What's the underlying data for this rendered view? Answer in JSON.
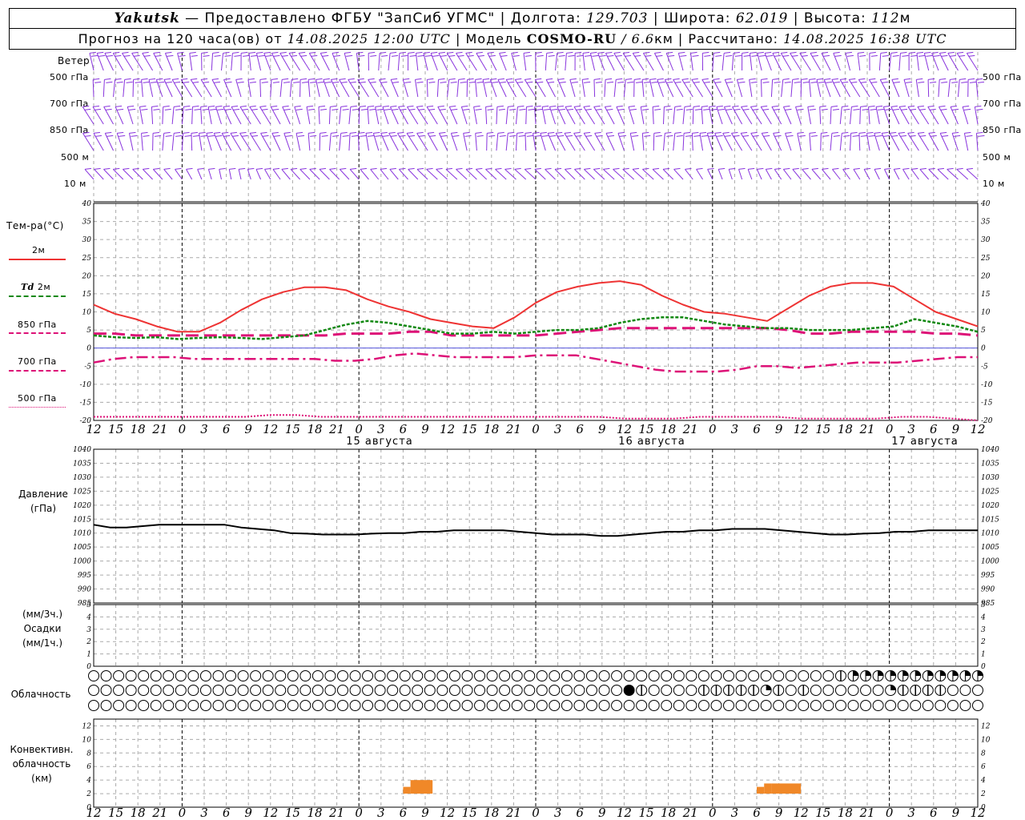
{
  "header": {
    "station": "Yakutsk",
    "provider": " — Предоставлено ФГБУ \"ЗапСиб УГМС\" | Долгота: ",
    "lon": "129.703",
    "lat_label": " | Широта: ",
    "lat": "62.019",
    "alt_label": " | Высота: ",
    "alt": "112",
    "alt_unit": "м",
    "forecast_label": "Прогноз на 120 часа(ов) от ",
    "forecast_time": "14.08.2025 12:00 UTC",
    "model_label": " | Модель ",
    "model": "COSMO-RU",
    "res_sep": " / ",
    "res": "6.6",
    "res_unit": "км",
    "calc_label": " | Рассчитано: ",
    "calc_time": "14.08.2025 16:38 UTC"
  },
  "labels": {
    "wind": "Ветер",
    "wind_levels": [
      "500 гПа",
      "700 гПа",
      "850 гПа",
      "500 м",
      "10 м"
    ],
    "temp": "Тем-ра(°С)",
    "t2m": "2м",
    "td_sym": "Td",
    "td_lvl": "2м",
    "t850": "850 гПа",
    "t700": "700 гПа",
    "t500": "500 гПа",
    "pressure": "Давление",
    "pressure_unit": "(гПа)",
    "precip_unit1": "(мм/3ч.)",
    "precip": "Осадки",
    "precip_unit2": "(мм/1ч.)",
    "clouds": "Облачность",
    "conv1": "Конвективн.",
    "conv2": "облачность",
    "conv3": "(км)"
  },
  "colors": {
    "t2m": "#ee3333",
    "td": "#118811",
    "t850": "#dd1177",
    "t700": "#dd1177",
    "t500": "#dd1177",
    "pressure": "#000000",
    "wind": "#8833dd",
    "conv": "#f08828",
    "grid": "#aaaaaa",
    "zero": "#5555dd"
  },
  "chart_data": [
    {
      "type": "line",
      "title": "Тем-ра(°С)",
      "x_hours": [
        0,
        3,
        6,
        9,
        12,
        15,
        18,
        21,
        24,
        27,
        30,
        33,
        36,
        39,
        42,
        45,
        48,
        51,
        54,
        57,
        60,
        63,
        66,
        69,
        72,
        75,
        78,
        81,
        84,
        87,
        90,
        93,
        96,
        99,
        102,
        105,
        108,
        111,
        114,
        117,
        120
      ],
      "x_tick_labels": [
        "12",
        "15",
        "18",
        "21",
        "0",
        "3",
        "6",
        "9",
        "12",
        "15",
        "18",
        "21",
        "0",
        "3",
        "6",
        "9",
        "12",
        "15",
        "18",
        "21",
        "0",
        "3",
        "6",
        "9",
        "12",
        "15",
        "18",
        "21",
        "0",
        "3",
        "6",
        "9",
        "12",
        "15",
        "18",
        "21",
        "0",
        "3",
        "6",
        "9",
        "12",
        "15",
        "18"
      ],
      "day_labels": [
        "15 августа",
        "16 августа",
        "17 августа"
      ],
      "ylim": [
        -20,
        40
      ],
      "y_ticks": [
        -20,
        -15,
        -10,
        -5,
        0,
        5,
        10,
        15,
        20,
        25,
        30,
        35,
        40
      ],
      "series": [
        {
          "name": "2м",
          "values": [
            12,
            9.5,
            8,
            6,
            4.5,
            4.5,
            7,
            10.5,
            13.5,
            15.5,
            16.8,
            16.8,
            16,
            13.5,
            11.5,
            10,
            8,
            7,
            6,
            5.5,
            8.5,
            12.5,
            15.5,
            17,
            18,
            18.5,
            17.5,
            14.5,
            12,
            10,
            9.5,
            8.5,
            7.5,
            11,
            14.5,
            17,
            18,
            18,
            17,
            13.5,
            10,
            8,
            6
          ]
        },
        {
          "name": "Td 2м",
          "values": [
            3.5,
            3,
            2.8,
            3,
            2.5,
            2.8,
            3,
            2.8,
            2.5,
            3,
            3.5,
            5,
            6.5,
            7.5,
            7,
            6,
            5,
            4,
            4,
            4.5,
            4,
            4.5,
            5,
            5,
            5.5,
            7,
            8,
            8.5,
            8.5,
            7.5,
            6.5,
            6,
            5.5,
            5.5,
            5,
            5,
            5,
            5.5,
            6,
            8,
            7,
            6,
            4.5
          ]
        },
        {
          "name": "850 гПа",
          "values": [
            4,
            4,
            3.5,
            3.5,
            3.5,
            3.5,
            3.5,
            3.5,
            3.5,
            3.5,
            3.5,
            3.5,
            4,
            4,
            4,
            4.5,
            4.5,
            3.5,
            3.5,
            3.5,
            3.5,
            3.5,
            4,
            4.5,
            5,
            5.5,
            5.5,
            5.5,
            5.5,
            5.5,
            5.5,
            5.5,
            5.5,
            5,
            4,
            4,
            4.5,
            4.5,
            4.5,
            4.5,
            4,
            4,
            3.5
          ]
        },
        {
          "name": "700 гПа",
          "values": [
            -4,
            -3,
            -2.5,
            -2.5,
            -2.5,
            -3,
            -3,
            -3,
            -3,
            -3,
            -3,
            -3,
            -3.5,
            -3.5,
            -3,
            -2,
            -1.5,
            -2,
            -2.5,
            -2.5,
            -2.5,
            -2.5,
            -2,
            -2,
            -2,
            -3,
            -4,
            -5,
            -6,
            -6.5,
            -6.5,
            -6.5,
            -6,
            -5,
            -5,
            -5.5,
            -5,
            -4.5,
            -4,
            -4,
            -4,
            -3.5,
            -3,
            -2.5,
            -2.5
          ]
        },
        {
          "name": "500 гПа",
          "values": [
            -19,
            -19,
            -19,
            -19,
            -19,
            -19,
            -19,
            -18.5,
            -18.5,
            -19,
            -19,
            -19,
            -19,
            -19,
            -19,
            -19,
            -19,
            -19,
            -19,
            -19,
            -19,
            -19.5,
            -19.5,
            -19.5,
            -19,
            -19,
            -19,
            -19,
            -19.5,
            -19.5,
            -19.5,
            -19.5,
            -19,
            -19,
            -19.5,
            -20
          ]
        }
      ]
    },
    {
      "type": "line",
      "title": "Давление",
      "ylabel": "(гПа)",
      "ylim": [
        985,
        1040
      ],
      "y_ticks": [
        985,
        990,
        995,
        1000,
        1005,
        1010,
        1015,
        1020,
        1025,
        1030,
        1035,
        1040
      ],
      "series": [
        {
          "name": "pressure",
          "values": [
            1013,
            1012,
            1012,
            1012.5,
            1013,
            1013,
            1013,
            1013,
            1013,
            1012,
            1011.5,
            1011,
            1010,
            1009.8,
            1009.5,
            1009.5,
            1009.5,
            1009.8,
            1010,
            1010,
            1010.5,
            1010.5,
            1011,
            1011,
            1011,
            1011,
            1010.5,
            1010,
            1009.5,
            1009.5,
            1009.5,
            1009,
            1009,
            1009.5,
            1010,
            1010.5,
            1010.5,
            1011,
            1011,
            1011.5,
            1011.5,
            1011.5,
            1011,
            1010.5,
            1010,
            1009.5,
            1009.5,
            1009.8,
            1010,
            1010.5,
            1010.5,
            1011,
            1011,
            1011,
            1011
          ]
        }
      ]
    },
    {
      "type": "bar",
      "title": "Осадки",
      "ylim": [
        0,
        5
      ],
      "y_ticks": [
        0,
        1,
        2,
        3,
        4,
        5
      ],
      "values": []
    },
    {
      "type": "bar",
      "title": "Конвективн. облачность (км)",
      "ylim": [
        0,
        13
      ],
      "y_ticks": [
        0,
        2,
        4,
        6,
        8,
        10,
        12
      ],
      "bars": [
        {
          "from_h": 42,
          "to_h": 43,
          "base": 2,
          "top": 3
        },
        {
          "from_h": 43,
          "to_h": 46,
          "base": 2,
          "top": 4
        },
        {
          "from_h": 90,
          "to_h": 91,
          "base": 2,
          "top": 3
        },
        {
          "from_h": 91,
          "to_h": 92,
          "base": 2,
          "top": 3.5
        },
        {
          "from_h": 92,
          "to_h": 96,
          "base": 2,
          "top": 3.5
        }
      ]
    }
  ],
  "clouds": {
    "count": 72,
    "rows": [
      {
        "overrides": [
          {
            "i": 60,
            "f": 0.5
          },
          {
            "i": 61,
            "f": 0.75
          },
          {
            "i": 62,
            "f": 0.75
          },
          {
            "i": 63,
            "f": 0.75
          },
          {
            "i": 64,
            "f": 0.75
          },
          {
            "i": 65,
            "f": 0.75
          },
          {
            "i": 66,
            "f": 0.75
          },
          {
            "i": 67,
            "f": 0.75
          },
          {
            "i": 68,
            "f": 0.75
          },
          {
            "i": 69,
            "f": 0.75
          },
          {
            "i": 70,
            "f": 0.75
          },
          {
            "i": 71,
            "f": 0.75
          }
        ]
      },
      {
        "overrides": [
          {
            "i": 43,
            "f": 1
          },
          {
            "i": 44,
            "f": 0.5
          },
          {
            "i": 49,
            "f": 0.5
          },
          {
            "i": 50,
            "f": 0.5
          },
          {
            "i": 51,
            "f": 0.5
          },
          {
            "i": 52,
            "f": 0.5
          },
          {
            "i": 53,
            "f": 0.5
          },
          {
            "i": 54,
            "f": 0.25
          },
          {
            "i": 55,
            "f": 0.5
          },
          {
            "i": 57,
            "f": 0.5
          },
          {
            "i": 64,
            "f": 0.25
          },
          {
            "i": 65,
            "f": 0.5
          },
          {
            "i": 66,
            "f": 0.5
          },
          {
            "i": 67,
            "f": 0.5
          },
          {
            "i": 68,
            "f": 0.5
          }
        ]
      },
      {
        "overrides": []
      }
    ]
  }
}
